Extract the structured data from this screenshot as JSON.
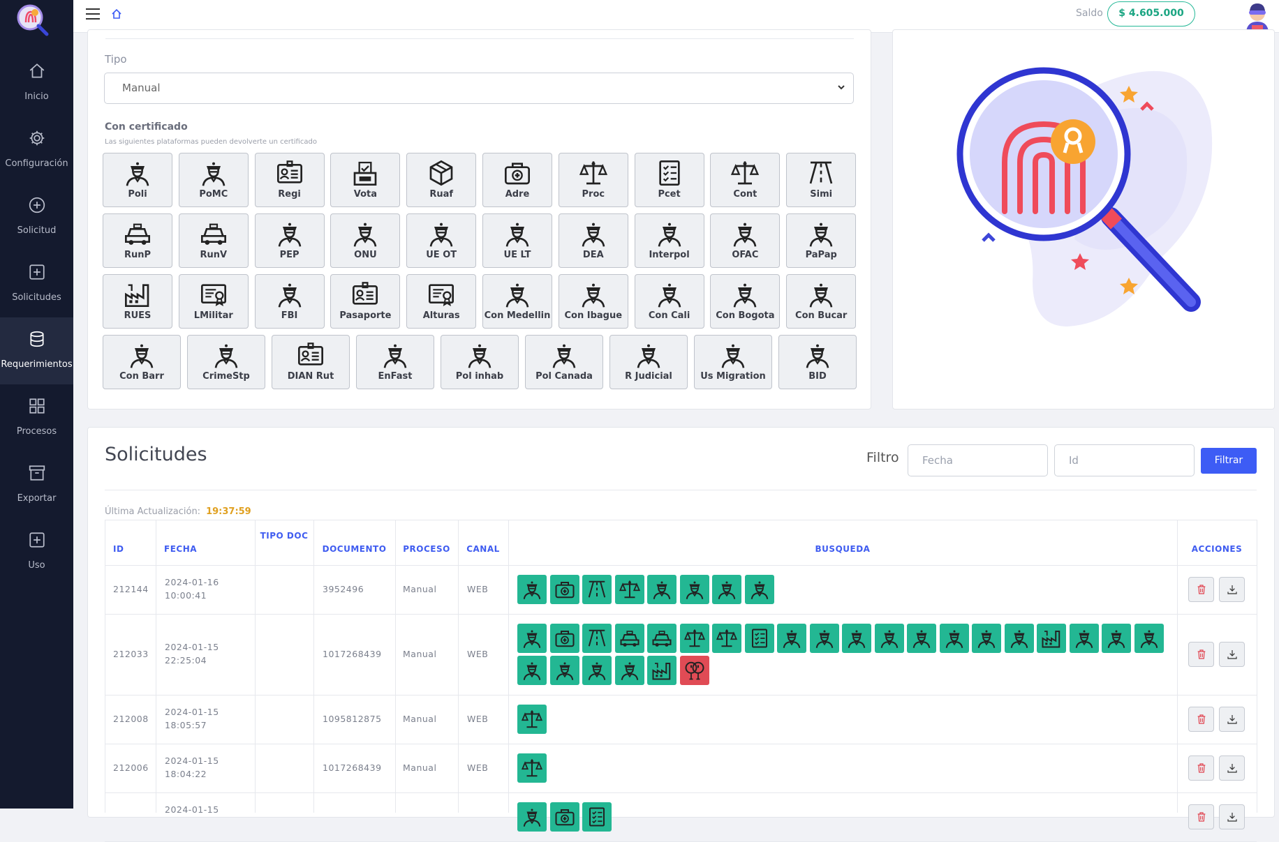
{
  "nav": [
    {
      "label": "Inicio",
      "icon": "home-icon"
    },
    {
      "label": "Configuración",
      "icon": "gear-icon"
    },
    {
      "label": "Solicitud",
      "icon": "plus-circle-icon"
    },
    {
      "label": "Solicitudes",
      "icon": "plus-square-icon"
    },
    {
      "label": "Requerimientos",
      "icon": "database-icon",
      "active": true
    },
    {
      "label": "Procesos",
      "icon": "grid-icon"
    },
    {
      "label": "Exportar",
      "icon": "archive-icon"
    },
    {
      "label": "Uso",
      "icon": "plus-square-icon"
    }
  ],
  "topbar": {
    "saldo_label": "Saldo",
    "saldo_value": "$ 4.605.000"
  },
  "form": {
    "tipo_label": "Tipo",
    "tipo_value": "Manual",
    "cert_title": "Con certificado",
    "cert_subtitle": "Las siguientes plataformas pueden devolverte un certificado"
  },
  "platforms": [
    [
      {
        "label": "Poli",
        "icon": "officer-icon"
      },
      {
        "label": "PoMC",
        "icon": "officer-icon"
      },
      {
        "label": "Regi",
        "icon": "id-card-icon"
      },
      {
        "label": "Vota",
        "icon": "ballot-box-icon"
      },
      {
        "label": "Ruaf",
        "icon": "box-icon"
      },
      {
        "label": "Adre",
        "icon": "medkit-icon"
      },
      {
        "label": "Proc",
        "icon": "scales-icon"
      },
      {
        "label": "Pcet",
        "icon": "checklist-icon"
      },
      {
        "label": "Cont",
        "icon": "scales-icon"
      },
      {
        "label": "Simi",
        "icon": "road-icon"
      }
    ],
    [
      {
        "label": "RunP",
        "icon": "car-icon"
      },
      {
        "label": "RunV",
        "icon": "car-icon"
      },
      {
        "label": "PEP",
        "icon": "officer-icon"
      },
      {
        "label": "ONU",
        "icon": "officer-icon"
      },
      {
        "label": "UE OT",
        "icon": "officer-icon"
      },
      {
        "label": "UE LT",
        "icon": "officer-icon"
      },
      {
        "label": "DEA",
        "icon": "officer-icon"
      },
      {
        "label": "Interpol",
        "icon": "officer-icon"
      },
      {
        "label": "OFAC",
        "icon": "officer-icon"
      },
      {
        "label": "PaPap",
        "icon": "officer-icon"
      }
    ],
    [
      {
        "label": "RUES",
        "icon": "factory-icon"
      },
      {
        "label": "LMilitar",
        "icon": "certificate-icon"
      },
      {
        "label": "FBI",
        "icon": "officer-icon"
      },
      {
        "label": "Pasaporte",
        "icon": "id-card-icon"
      },
      {
        "label": "Alturas",
        "icon": "certificate-icon"
      },
      {
        "label": "Con Medellin",
        "icon": "officer-icon"
      },
      {
        "label": "Con Ibague",
        "icon": "officer-icon"
      },
      {
        "label": "Con Cali",
        "icon": "officer-icon"
      },
      {
        "label": "Con Bogota",
        "icon": "officer-icon"
      },
      {
        "label": "Con Bucar",
        "icon": "officer-icon"
      }
    ],
    [
      {
        "label": "Con Barr",
        "icon": "officer-icon"
      },
      {
        "label": "CrimeStp",
        "icon": "officer-icon"
      },
      {
        "label": "DIAN Rut",
        "icon": "id-card-icon"
      },
      {
        "label": "EnFast",
        "icon": "officer-icon"
      },
      {
        "label": "Pol inhab",
        "icon": "officer-icon"
      },
      {
        "label": "Pol Canada",
        "icon": "officer-icon"
      },
      {
        "label": "R Judicial",
        "icon": "officer-icon"
      },
      {
        "label": "Us Migration",
        "icon": "officer-icon"
      },
      {
        "label": "BID",
        "icon": "officer-icon"
      }
    ]
  ],
  "solicitudes": {
    "title": "Solicitudes",
    "filtro_label": "Filtro",
    "fecha_placeholder": "Fecha",
    "id_placeholder": "Id",
    "filtrar_label": "Filtrar",
    "last_update_label": "Última Actualización:",
    "last_update_time": "19:37:59",
    "columns": [
      "ID",
      "FECHA",
      "TIPO DOC",
      "DOCUMENTO",
      "PROCESO",
      "CANAL",
      "BUSQUEDA",
      "ACCIONES"
    ],
    "rows": [
      {
        "id": "212144",
        "fecha": "2024-01-16",
        "hora": "10:00:41",
        "tipo_doc": "",
        "documento": "3952496",
        "proceso": "Manual",
        "canal": "WEB",
        "busqueda": [
          [
            "officer-icon",
            "medkit-icon",
            "road-icon",
            "scales-icon",
            "officer-icon",
            "officer-icon",
            "officer-icon",
            "officer-icon"
          ]
        ]
      },
      {
        "id": "212033",
        "fecha": "2024-01-15",
        "hora": "22:25:04",
        "tipo_doc": "",
        "documento": "1017268439",
        "proceso": "Manual",
        "canal": "WEB",
        "busqueda": [
          [
            "officer-icon",
            "medkit-icon",
            "road-icon",
            "car-icon",
            "car-icon",
            "scales-icon",
            "scales-icon",
            "checklist-icon",
            "officer-icon",
            "officer-icon",
            "officer-icon",
            "officer-icon",
            "officer-icon",
            "officer-icon",
            "officer-icon",
            "officer-icon",
            "factory-icon",
            "officer-icon",
            "officer-icon",
            "officer-icon"
          ],
          [
            "officer-icon",
            "officer-icon",
            "officer-icon",
            "officer-icon",
            "factory-icon",
            "alert-icon"
          ]
        ]
      },
      {
        "id": "212008",
        "fecha": "2024-01-15",
        "hora": "18:05:57",
        "tipo_doc": "",
        "documento": "1095812875",
        "proceso": "Manual",
        "canal": "WEB",
        "busqueda": [
          [
            "scales-icon"
          ]
        ]
      },
      {
        "id": "212006",
        "fecha": "2024-01-15",
        "hora": "18:04:22",
        "tipo_doc": "",
        "documento": "1017268439",
        "proceso": "Manual",
        "canal": "WEB",
        "busqueda": [
          [
            "scales-icon"
          ]
        ]
      },
      {
        "id": "",
        "fecha": "2024-01-15",
        "hora": "",
        "tipo_doc": "",
        "documento": "",
        "proceso": "",
        "canal": "",
        "busqueda": [
          [
            "officer-icon",
            "medkit-icon",
            "checklist-icon"
          ]
        ]
      }
    ]
  },
  "colors": {
    "sidebar": "#141a2e",
    "accent": "#3d5cf5",
    "chip_ok": "#23b793",
    "chip_err": "#e04b55",
    "saldo": "#25b897"
  }
}
